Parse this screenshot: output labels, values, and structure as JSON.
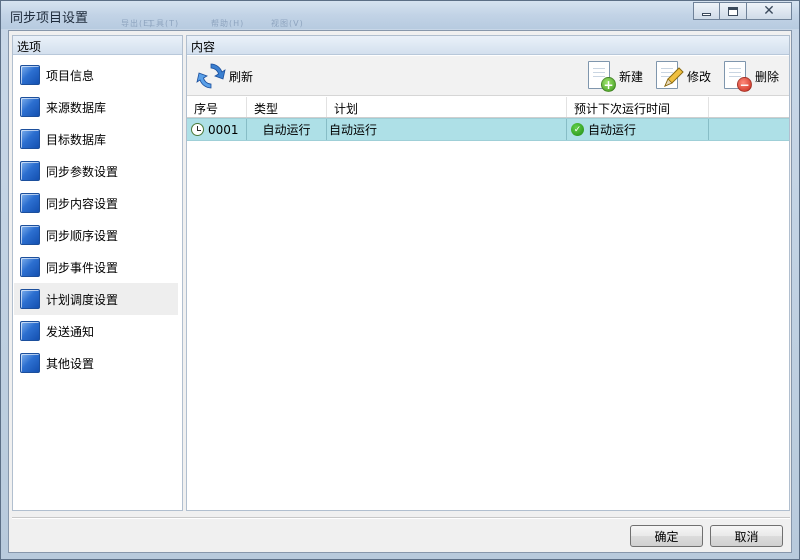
{
  "window": {
    "title": "同步项目设置",
    "ghost_menu": [
      "导出(E)",
      "工具(T)",
      "帮助(H)",
      "视图(V)"
    ]
  },
  "left_panel": {
    "header": "选项",
    "items": [
      {
        "label": "项目信息",
        "icon": "blue-square-icon"
      },
      {
        "label": "来源数据库",
        "icon": "blue-square-icon"
      },
      {
        "label": "目标数据库",
        "icon": "blue-square-icon"
      },
      {
        "label": "同步参数设置",
        "icon": "blue-square-icon"
      },
      {
        "label": "同步内容设置",
        "icon": "blue-square-icon"
      },
      {
        "label": "同步顺序设置",
        "icon": "blue-square-icon"
      },
      {
        "label": "同步事件设置",
        "icon": "blue-square-icon"
      },
      {
        "label": "计划调度设置",
        "icon": "blue-square-icon",
        "selected": true
      },
      {
        "label": "发送通知",
        "icon": "blue-square-icon"
      },
      {
        "label": "其他设置",
        "icon": "blue-square-icon"
      }
    ]
  },
  "right_panel": {
    "header": "内容",
    "toolbar": {
      "refresh_label": "刷新",
      "new_label": "新建",
      "edit_label": "修改",
      "delete_label": "删除"
    },
    "table": {
      "columns": [
        "序号",
        "类型",
        "计划",
        "预计下次运行时间",
        ""
      ],
      "rows": [
        {
          "no": "0001",
          "type": "自动运行",
          "plan": "自动运行",
          "next_run": "自动运行",
          "extra": ""
        }
      ]
    }
  },
  "footer": {
    "ok_label": "确定",
    "cancel_label": "取消"
  },
  "colors": {
    "selected_row": "#aee0e7",
    "nav_icon": "#2c6fd0",
    "titlebar": "#c2d3e6"
  }
}
